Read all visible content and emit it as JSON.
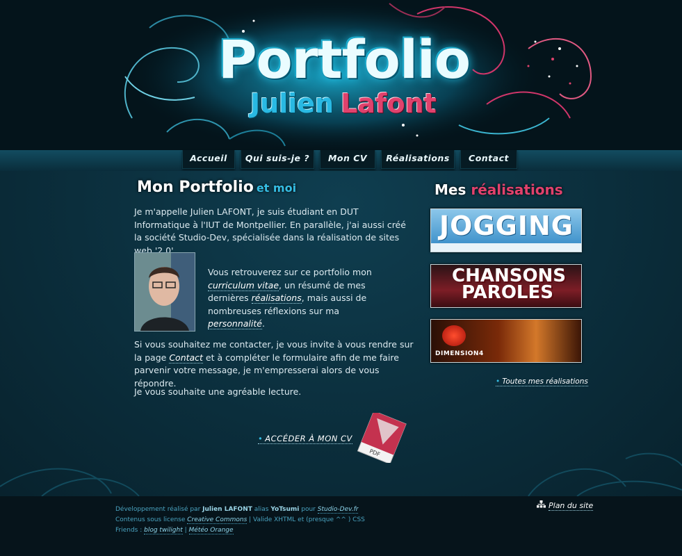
{
  "header": {
    "title": "Portfolio",
    "first_name": "Julien",
    "last_name": "Lafont"
  },
  "nav": {
    "items": [
      {
        "label": "Accueil"
      },
      {
        "label": "Qui suis-je ?"
      },
      {
        "label": "Mon CV"
      },
      {
        "label": "Réalisations"
      },
      {
        "label": "Contact"
      }
    ]
  },
  "intro": {
    "title": "Mon Portfolio",
    "title_accent": "et moi",
    "p1": "Je m'appelle Julien LAFONT, je suis étudiant en DUT Informatique à l'IUT de Montpellier. En parallèle, j'ai aussi créé la société Studio-Dev, spécialisée dans la réalisation de sites web '2.0'.",
    "p2_a": "Vous retrouverez sur ce portfolio mon ",
    "p2_link1": "curriculum vitae",
    "p2_b": ", un résumé de mes dernières ",
    "p2_link2": "réalisations",
    "p2_c": ", mais aussi de nombreuses réflexions sur ma ",
    "p2_link3": "personnalité",
    "p2_d": ".",
    "p3_a": "Si vous souhaitez me contacter, je vous invite à vous rendre sur la page ",
    "p3_link": "Contact",
    "p3_b": " et à compléter le formulaire afin de me faire parvenir votre message, je m'empresserai alors de vous répondre.",
    "p4": "Je vous souhaite une agréable lecture.",
    "cv_link": "ACCÉDER À MON CV",
    "pdf_label": "PDF"
  },
  "realisations": {
    "title": "Mes",
    "title_accent": "réalisations",
    "items": [
      {
        "label": "JOGGING"
      },
      {
        "label": "CHANSONS PAROLES"
      },
      {
        "label": "DIMENSION4"
      }
    ],
    "all_link": "Toutes mes réalisations"
  },
  "footer": {
    "l1_a": "Développement réalisé par ",
    "l1_name": "Julien LAFONT",
    "l1_b": " alias ",
    "l1_alias": "YoTsumi",
    "l1_c": " pour ",
    "l1_link": "Studio-Dev.fr",
    "l2_a": "Contenus sous license ",
    "l2_link": "Creative Commons",
    "l2_b": " | Valide XHTML et (presque ^^ ) CSS",
    "l3_a": "Friends : ",
    "l3_link1": "blog twilight",
    "l3_sep": " | ",
    "l3_link2": "Météo Orange",
    "sitemap": "Plan du site"
  },
  "colors": {
    "accent_blue": "#35bde3",
    "accent_pink": "#e2416c",
    "background": "#0a2734"
  }
}
